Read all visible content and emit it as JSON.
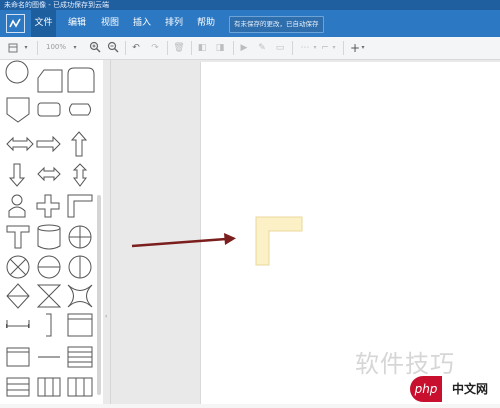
{
  "titlebar": {
    "text": "未命名的图像 - 已成功保存到云端"
  },
  "menu": {
    "items": [
      {
        "label": "文件"
      },
      {
        "label": "编辑"
      },
      {
        "label": "视图"
      },
      {
        "label": "插入"
      },
      {
        "label": "排列"
      },
      {
        "label": "帮助"
      }
    ],
    "notice": "有未保存的更改，已自动保存"
  },
  "toolbar": {
    "zoom": "100%",
    "plus": "+"
  },
  "watermark": {
    "text": "软件技巧",
    "badge_php": "php",
    "badge_cn": "中文网"
  },
  "colors": {
    "arrow": "#7b1e1e",
    "shape_fill": "#fbf0c6",
    "shape_stroke": "#e8d89a",
    "accent": "#2c78c3"
  }
}
